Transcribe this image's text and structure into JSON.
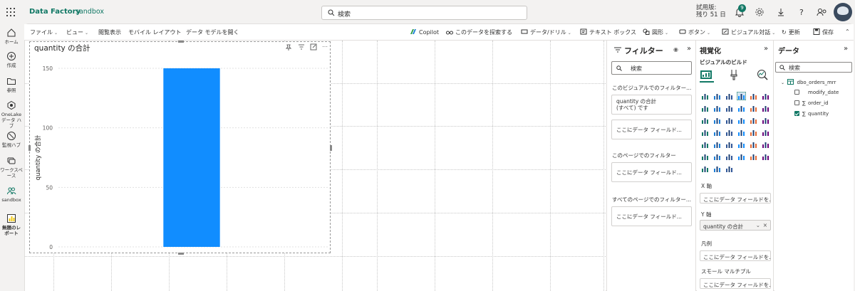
{
  "topbar": {
    "brand": "Data Factory",
    "workspace": "sandbox",
    "search_placeholder": "検索",
    "trial_line1": "試用版:",
    "trial_line2": "残り 51 日",
    "notification_count": "9"
  },
  "rail": {
    "items": [
      {
        "label": "ホーム"
      },
      {
        "label": "作成"
      },
      {
        "label": "参照"
      },
      {
        "label": "OneLake データ ハブ"
      },
      {
        "label": "監視ハブ"
      },
      {
        "label": "ワークスペース"
      },
      {
        "label": "sandbox"
      },
      {
        "label": "無題のレポート"
      }
    ]
  },
  "ribbon": {
    "file": "ファイル",
    "view": "ビュー",
    "reading_view": "閲覧表示",
    "mobile_layout": "モバイル レイアウト",
    "open_model": "データ モデルを開く",
    "copilot": "Copilot",
    "explore": "このデータを探索する",
    "data_drill": "データ/ドリル",
    "textbox": "テキスト ボックス",
    "shapes": "図形",
    "buttons": "ボタン",
    "visual_interactions": "ビジュアル対話",
    "refresh": "更新",
    "save": "保存"
  },
  "visual": {
    "title": "quantity の合計"
  },
  "chart_data": {
    "type": "bar",
    "title": "quantity の合計",
    "categories": [
      ""
    ],
    "series": [
      {
        "values": [
          150
        ]
      }
    ],
    "ylabel": "quantity の合計",
    "xlabel": "",
    "ylim": [
      0,
      150
    ],
    "yticks": [
      "150",
      "100",
      "50",
      "0"
    ],
    "grid": true,
    "bar_color": "#118dff"
  },
  "filters": {
    "title": "フィルター",
    "search_placeholder": "検索",
    "visual_section": "このビジュアルでのフィルター...",
    "card_line1": "quantity の合計",
    "card_line2": "(すべて) です",
    "add_field": "ここにデータ フィールド...",
    "page_section": "このページでのフィルター",
    "all_pages_section": "すべてのページでのフィルター..."
  },
  "viz": {
    "title": "視覚化",
    "build_label": "ビジュアルのビルド",
    "x_axis": "X 軸",
    "x_placeholder": "ここにデータ フィールドを...",
    "y_axis": "Y 軸",
    "y_value": "quantity の合計",
    "legend": "凡例",
    "legend_placeholder": "ここにデータ フィールドを...",
    "small_multiples": "スモール マルチプル",
    "sm_placeholder": "ここにデータ フィールドを..."
  },
  "data_pane": {
    "title": "データ",
    "search_placeholder": "検索",
    "table": "dbo_orders_mrr",
    "fields": [
      {
        "name": "modify_date",
        "sigma": "",
        "checked": false
      },
      {
        "name": "order_id",
        "sigma": "∑",
        "checked": false
      },
      {
        "name": "quantity",
        "sigma": "∑",
        "checked": true
      }
    ]
  },
  "colors": {
    "accent": "#117865",
    "bar": "#118dff"
  }
}
